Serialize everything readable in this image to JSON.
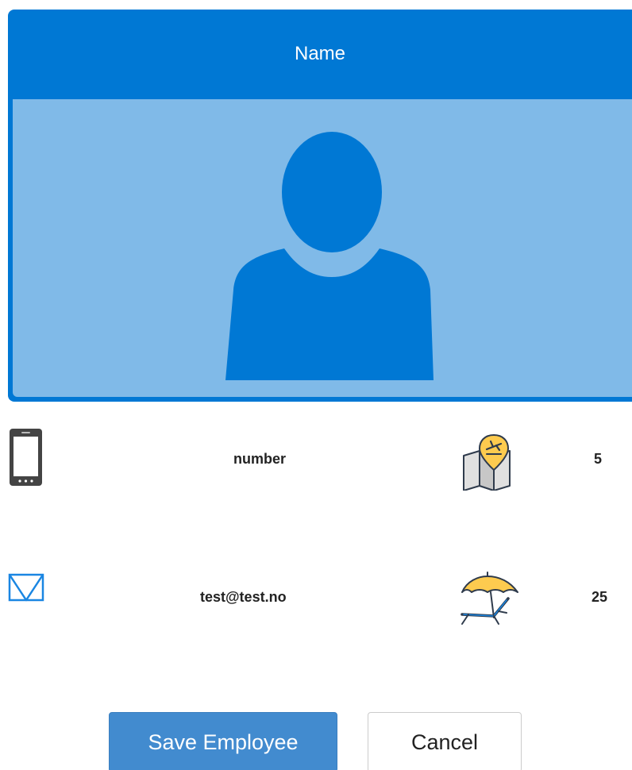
{
  "card": {
    "name_label": "Name"
  },
  "details": {
    "phone": "number",
    "email": "test@test.no",
    "travel_days": "5",
    "vacation_days": "25"
  },
  "actions": {
    "save_label": "Save Employee",
    "cancel_label": "Cancel"
  },
  "colors": {
    "header_blue": "#0078d4",
    "photo_bg": "#80bae8",
    "save_button": "#428bcf"
  },
  "icons": {
    "phone": "mobile-phone-icon",
    "email": "envelope-icon",
    "travel": "travel-map-icon",
    "vacation": "beach-lounger-icon",
    "avatar": "person-silhouette-icon"
  }
}
